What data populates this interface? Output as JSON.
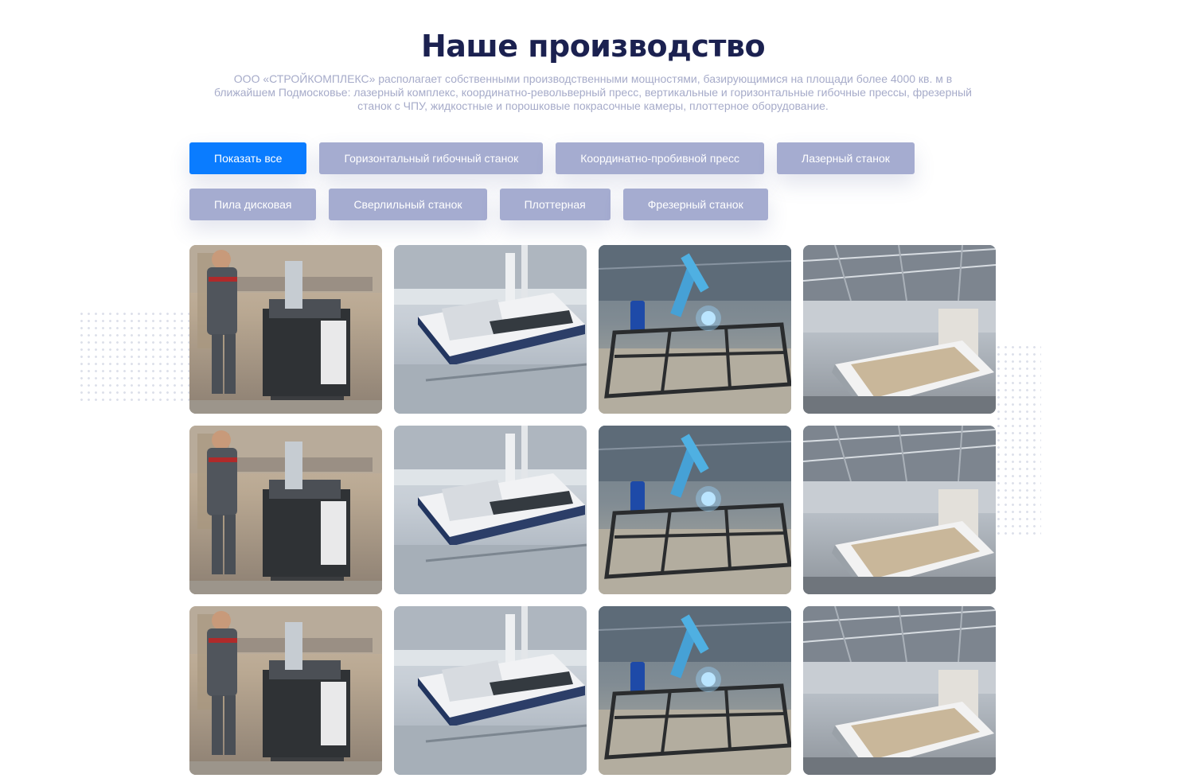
{
  "section": {
    "title": "Наше производство",
    "description": "ООО «СТРОЙКОМПЛЕКС» располагает собственными производственными мощностями, базирующимися на площади более 4000 кв. м в ближайшем Подмосковье: лазерный комплекс, координатно-револьверный пресс, вертикальные и горизонтальные гибочные прессы, фрезерный станок с ЧПУ, жидкостные и порошковые покрасочные камеры, плоттерное оборудование."
  },
  "filters": {
    "row1": [
      "Показать все",
      "Горизонтальный гибочный станок",
      "Координатно-пробивной пресс",
      "Лазерный станок"
    ],
    "row2": [
      "Пила дисковая",
      "Сверлильный станок",
      "Плоттерная",
      "Фрезерный станок"
    ],
    "active_index": 0
  },
  "colors": {
    "title": "#1b2150",
    "active_button": "#0a7cff",
    "inactive_button": "#a5acd0",
    "subtitle": "#a6abc9"
  },
  "gallery": {
    "rows": 3,
    "columns": 4,
    "photo_subjects": [
      "bending-machine-operator",
      "laser-cutting-machine",
      "welding-robot",
      "cnc-milling-machine"
    ]
  }
}
